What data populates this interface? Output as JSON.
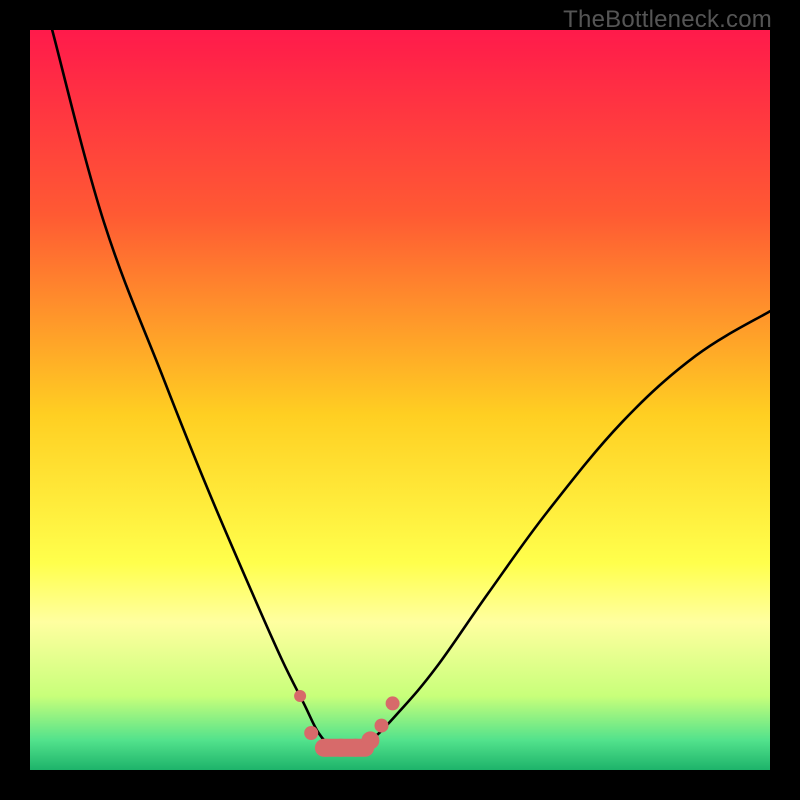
{
  "watermark": "TheBottleneck.com",
  "colors": {
    "frame": "#000000",
    "watermark": "#555555",
    "curve": "#000000",
    "markers": "#d76a6a",
    "gradient_stops": [
      {
        "pct": 0,
        "color": "#ff1a4b"
      },
      {
        "pct": 25,
        "color": "#ff5a33"
      },
      {
        "pct": 52,
        "color": "#ffcf22"
      },
      {
        "pct": 72,
        "color": "#ffff4c"
      },
      {
        "pct": 80,
        "color": "#ffffa0"
      },
      {
        "pct": 90,
        "color": "#c8ff7a"
      },
      {
        "pct": 96,
        "color": "#52e28c"
      },
      {
        "pct": 100,
        "color": "#1db36a"
      }
    ]
  },
  "chart_data": {
    "type": "line",
    "title": "",
    "xlabel": "",
    "ylabel": "",
    "x_range": [
      0,
      100
    ],
    "y_range": [
      0,
      100
    ],
    "note": "Axes are unlabeled; values are read as percent of plotting area (0–100). y=0 is bottom, x=0 is left.",
    "series": [
      {
        "name": "bottleneck-curve",
        "x": [
          3,
          10,
          18,
          24,
          30,
          34,
          37,
          39,
          41,
          43,
          46,
          50,
          55,
          62,
          70,
          80,
          90,
          100
        ],
        "y": [
          100,
          74,
          53,
          38,
          24,
          15,
          9,
          5,
          3,
          3,
          4,
          8,
          14,
          24,
          35,
          47,
          56,
          62
        ]
      }
    ],
    "markers": {
      "name": "highlighted-points",
      "x": [
        36.5,
        38,
        40,
        42,
        44,
        46,
        47.5,
        49
      ],
      "y": [
        10,
        5,
        3,
        3,
        3,
        4,
        6,
        9
      ],
      "size": [
        6,
        7,
        9,
        9,
        9,
        9,
        7,
        7
      ]
    }
  }
}
